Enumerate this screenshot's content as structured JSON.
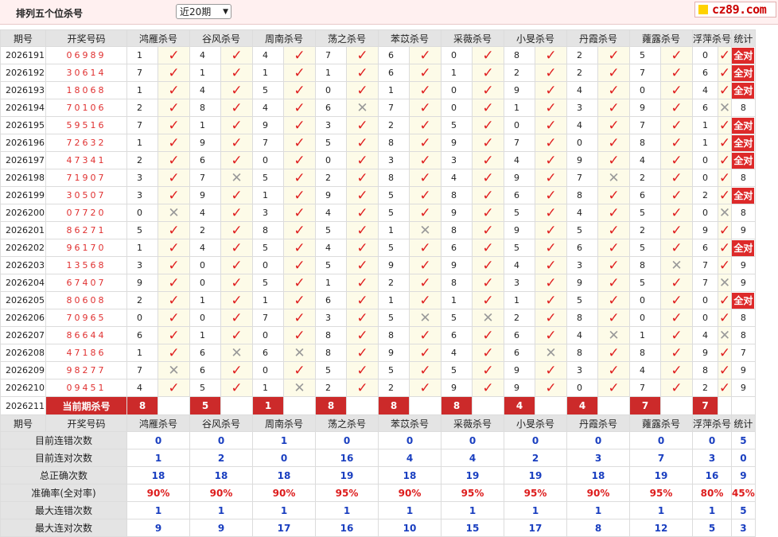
{
  "header": {
    "title": "排列五个位杀号",
    "period_select": "近20期",
    "logo_text": "cz89.com"
  },
  "columns": [
    "期号",
    "开奖号码",
    "鸿雁杀号",
    "谷风杀号",
    "周南杀号",
    "荡之杀号",
    "苯苡杀号",
    "采薇杀号",
    "小旻杀号",
    "丹霞杀号",
    "蕹露杀号",
    "浮萍杀号",
    "统计"
  ],
  "rows": [
    {
      "id": "2026191",
      "code": "06989",
      "kills": [
        "1",
        "4",
        "4",
        "7",
        "6",
        "0",
        "8",
        "2",
        "5",
        "0"
      ],
      "hits": [
        1,
        1,
        1,
        1,
        1,
        1,
        1,
        1,
        1,
        1
      ],
      "stat": "全对"
    },
    {
      "id": "2026192",
      "code": "30614",
      "kills": [
        "7",
        "1",
        "1",
        "1",
        "6",
        "1",
        "2",
        "2",
        "7",
        "6"
      ],
      "hits": [
        1,
        1,
        1,
        1,
        1,
        1,
        1,
        1,
        1,
        1
      ],
      "stat": "全对"
    },
    {
      "id": "2026193",
      "code": "18068",
      "kills": [
        "1",
        "4",
        "5",
        "0",
        "1",
        "0",
        "9",
        "4",
        "0",
        "4"
      ],
      "hits": [
        1,
        1,
        1,
        1,
        1,
        1,
        1,
        1,
        1,
        1
      ],
      "stat": "全对"
    },
    {
      "id": "2026194",
      "code": "70106",
      "kills": [
        "2",
        "8",
        "4",
        "6",
        "7",
        "0",
        "1",
        "3",
        "9",
        "6"
      ],
      "hits": [
        1,
        1,
        1,
        0,
        1,
        1,
        1,
        1,
        1,
        0
      ],
      "stat": "8"
    },
    {
      "id": "2026195",
      "code": "59516",
      "kills": [
        "7",
        "1",
        "9",
        "3",
        "2",
        "5",
        "0",
        "4",
        "7",
        "1"
      ],
      "hits": [
        1,
        1,
        1,
        1,
        1,
        1,
        1,
        1,
        1,
        1
      ],
      "stat": "全对"
    },
    {
      "id": "2026196",
      "code": "72632",
      "kills": [
        "1",
        "9",
        "7",
        "5",
        "8",
        "9",
        "7",
        "0",
        "8",
        "1"
      ],
      "hits": [
        1,
        1,
        1,
        1,
        1,
        1,
        1,
        1,
        1,
        1
      ],
      "stat": "全对"
    },
    {
      "id": "2026197",
      "code": "47341",
      "kills": [
        "2",
        "6",
        "0",
        "0",
        "3",
        "3",
        "4",
        "9",
        "4",
        "0"
      ],
      "hits": [
        1,
        1,
        1,
        1,
        1,
        1,
        1,
        1,
        1,
        1
      ],
      "stat": "全对"
    },
    {
      "id": "2026198",
      "code": "71907",
      "kills": [
        "3",
        "7",
        "5",
        "2",
        "8",
        "4",
        "9",
        "7",
        "2",
        "0"
      ],
      "hits": [
        1,
        0,
        1,
        1,
        1,
        1,
        1,
        0,
        1,
        1
      ],
      "stat": "8"
    },
    {
      "id": "2026199",
      "code": "30507",
      "kills": [
        "3",
        "9",
        "1",
        "9",
        "5",
        "8",
        "6",
        "8",
        "6",
        "2"
      ],
      "hits": [
        1,
        1,
        1,
        1,
        1,
        1,
        1,
        1,
        1,
        1
      ],
      "stat": "全对"
    },
    {
      "id": "2026200",
      "code": "07720",
      "kills": [
        "0",
        "4",
        "3",
        "4",
        "5",
        "9",
        "5",
        "4",
        "5",
        "0"
      ],
      "hits": [
        0,
        1,
        1,
        1,
        1,
        1,
        1,
        1,
        1,
        0
      ],
      "stat": "8"
    },
    {
      "id": "2026201",
      "code": "86271",
      "kills": [
        "5",
        "2",
        "8",
        "5",
        "1",
        "8",
        "9",
        "5",
        "2",
        "9"
      ],
      "hits": [
        1,
        1,
        1,
        1,
        0,
        1,
        1,
        1,
        1,
        1
      ],
      "stat": "9"
    },
    {
      "id": "2026202",
      "code": "96170",
      "kills": [
        "1",
        "4",
        "5",
        "4",
        "5",
        "6",
        "5",
        "6",
        "5",
        "6"
      ],
      "hits": [
        1,
        1,
        1,
        1,
        1,
        1,
        1,
        1,
        1,
        1
      ],
      "stat": "全对"
    },
    {
      "id": "2026203",
      "code": "13568",
      "kills": [
        "3",
        "0",
        "0",
        "5",
        "9",
        "9",
        "4",
        "3",
        "8",
        "7"
      ],
      "hits": [
        1,
        1,
        1,
        1,
        1,
        1,
        1,
        1,
        0,
        1
      ],
      "stat": "9"
    },
    {
      "id": "2026204",
      "code": "67407",
      "kills": [
        "9",
        "0",
        "5",
        "1",
        "2",
        "8",
        "3",
        "9",
        "5",
        "7"
      ],
      "hits": [
        1,
        1,
        1,
        1,
        1,
        1,
        1,
        1,
        1,
        0
      ],
      "stat": "9"
    },
    {
      "id": "2026205",
      "code": "80608",
      "kills": [
        "2",
        "1",
        "1",
        "6",
        "1",
        "1",
        "1",
        "5",
        "0",
        "0"
      ],
      "hits": [
        1,
        1,
        1,
        1,
        1,
        1,
        1,
        1,
        1,
        1
      ],
      "stat": "全对"
    },
    {
      "id": "2026206",
      "code": "70965",
      "kills": [
        "0",
        "0",
        "7",
        "3",
        "5",
        "5",
        "2",
        "8",
        "0",
        "0"
      ],
      "hits": [
        1,
        1,
        1,
        1,
        0,
        0,
        1,
        1,
        1,
        1
      ],
      "stat": "8"
    },
    {
      "id": "2026207",
      "code": "86644",
      "kills": [
        "6",
        "1",
        "0",
        "8",
        "8",
        "6",
        "6",
        "4",
        "1",
        "4"
      ],
      "hits": [
        1,
        1,
        1,
        1,
        1,
        1,
        1,
        0,
        1,
        0
      ],
      "stat": "8"
    },
    {
      "id": "2026208",
      "code": "47186",
      "kills": [
        "1",
        "6",
        "6",
        "8",
        "9",
        "4",
        "6",
        "8",
        "8",
        "9"
      ],
      "hits": [
        1,
        0,
        0,
        1,
        1,
        1,
        0,
        1,
        1,
        1
      ],
      "stat": "7"
    },
    {
      "id": "2026209",
      "code": "98277",
      "kills": [
        "7",
        "6",
        "0",
        "5",
        "5",
        "5",
        "9",
        "3",
        "4",
        "8"
      ],
      "hits": [
        0,
        1,
        1,
        1,
        1,
        1,
        1,
        1,
        1,
        1
      ],
      "stat": "9"
    },
    {
      "id": "2026210",
      "code": "09451",
      "kills": [
        "4",
        "5",
        "1",
        "2",
        "2",
        "9",
        "9",
        "0",
        "7",
        "2"
      ],
      "hits": [
        1,
        1,
        0,
        1,
        1,
        1,
        1,
        1,
        1,
        1
      ],
      "stat": "9"
    }
  ],
  "current": {
    "id": "2026211",
    "label": "当前期杀号",
    "kills": [
      "8",
      "5",
      "1",
      "8",
      "8",
      "8",
      "4",
      "4",
      "7",
      "7"
    ]
  },
  "footer_columns": [
    "期号",
    "开奖号码",
    "鸿雁杀号",
    "谷风杀号",
    "周南杀号",
    "荡之杀号",
    "苯苡杀号",
    "采薇杀号",
    "小旻杀号",
    "丹霞杀号",
    "蕹露杀号",
    "浮萍杀号",
    "统计"
  ],
  "stats": [
    {
      "label": "目前连错次数",
      "values": [
        "0",
        "0",
        "1",
        "0",
        "0",
        "0",
        "0",
        "0",
        "0",
        "0",
        "5"
      ],
      "red": false
    },
    {
      "label": "目前连对次数",
      "values": [
        "1",
        "2",
        "0",
        "16",
        "4",
        "4",
        "2",
        "3",
        "7",
        "3",
        "0"
      ],
      "red": false
    },
    {
      "label": "总正确次数",
      "values": [
        "18",
        "18",
        "18",
        "19",
        "18",
        "19",
        "19",
        "18",
        "19",
        "16",
        "9"
      ],
      "red": false
    },
    {
      "label": "准确率(全对率)",
      "values": [
        "90%",
        "90%",
        "90%",
        "95%",
        "90%",
        "95%",
        "95%",
        "90%",
        "95%",
        "80%",
        "45%"
      ],
      "red": true
    },
    {
      "label": "最大连错次数",
      "values": [
        "1",
        "1",
        "1",
        "1",
        "1",
        "1",
        "1",
        "1",
        "1",
        "1",
        "5"
      ],
      "red": false
    },
    {
      "label": "最大连对次数",
      "values": [
        "9",
        "9",
        "17",
        "16",
        "10",
        "15",
        "17",
        "8",
        "12",
        "5",
        "3"
      ],
      "red": false
    }
  ],
  "icons": {
    "hit": "check-icon",
    "miss": "cross-icon"
  },
  "colors": {
    "hit": "#e02020",
    "miss": "#999999",
    "badge": "#dd2a2a",
    "stat_value": "#1a3fc0",
    "rate": "#dd1c1c"
  }
}
